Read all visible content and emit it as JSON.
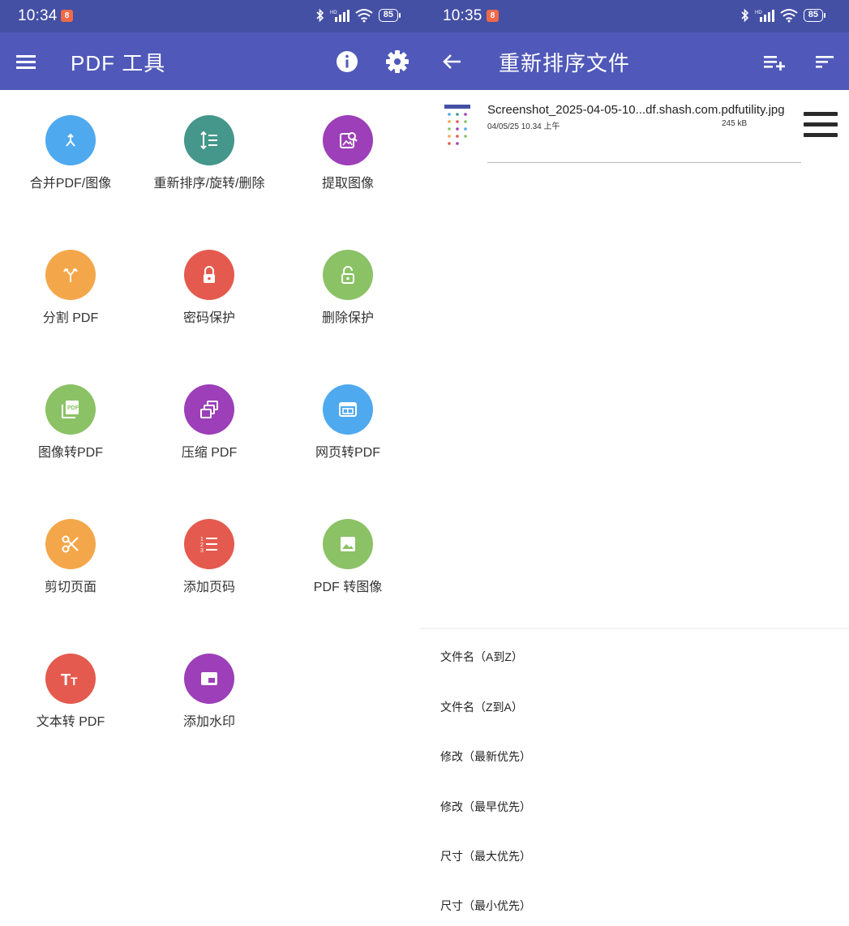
{
  "left_screen": {
    "status": {
      "time": "10:34",
      "battery": "85"
    },
    "appbar": {
      "title": "PDF 工具"
    },
    "tools": [
      {
        "label": "合并PDF/图像",
        "icon": "merge-icon",
        "color": "#4fa9ee"
      },
      {
        "label": "重新排序/旋转/删除",
        "icon": "reorder-icon",
        "color": "#44978a"
      },
      {
        "label": "提取图像",
        "icon": "extract-image-icon",
        "color": "#9c3fb8"
      },
      {
        "label": "分割 PDF",
        "icon": "split-icon",
        "color": "#f4a74a"
      },
      {
        "label": "密码保护",
        "icon": "lock-icon",
        "color": "#e55a4e"
      },
      {
        "label": "删除保护",
        "icon": "unlock-icon",
        "color": "#8bc265"
      },
      {
        "label": "图像转PDF",
        "icon": "image-to-pdf-icon",
        "color": "#8bc265"
      },
      {
        "label": "压缩 PDF",
        "icon": "compress-icon",
        "color": "#9c3fb8"
      },
      {
        "label": "网页转PDF",
        "icon": "web-to-pdf-icon",
        "color": "#4fa9ee"
      },
      {
        "label": "剪切页面",
        "icon": "scissors-icon",
        "color": "#f4a74a"
      },
      {
        "label": "添加页码",
        "icon": "page-numbers-icon",
        "color": "#e55a4e"
      },
      {
        "label": "PDF 转图像",
        "icon": "pdf-to-image-icon",
        "color": "#8bc265"
      },
      {
        "label": "文本转 PDF",
        "icon": "text-to-pdf-icon",
        "color": "#e55a4e"
      },
      {
        "label": "添加水印",
        "icon": "watermark-icon",
        "color": "#9c3fb8"
      }
    ]
  },
  "right_screen": {
    "status": {
      "time": "10:35",
      "battery": "85"
    },
    "appbar": {
      "title": "重新排序文件"
    },
    "file": {
      "name": "Screenshot_2025-04-05-10...df.shash.com.pdfutility.jpg",
      "date": "04/05/25 10.34 上午",
      "size": "245 kB"
    },
    "sort_options": [
      "文件名（A到Z）",
      "文件名（Z到A）",
      "修改（最新优先）",
      "修改（最早优先）",
      "尺寸（最大优先）",
      "尺寸（最小优先）"
    ]
  },
  "colors": {
    "statusbar": "#4450a4",
    "appbar": "#5059b9"
  }
}
